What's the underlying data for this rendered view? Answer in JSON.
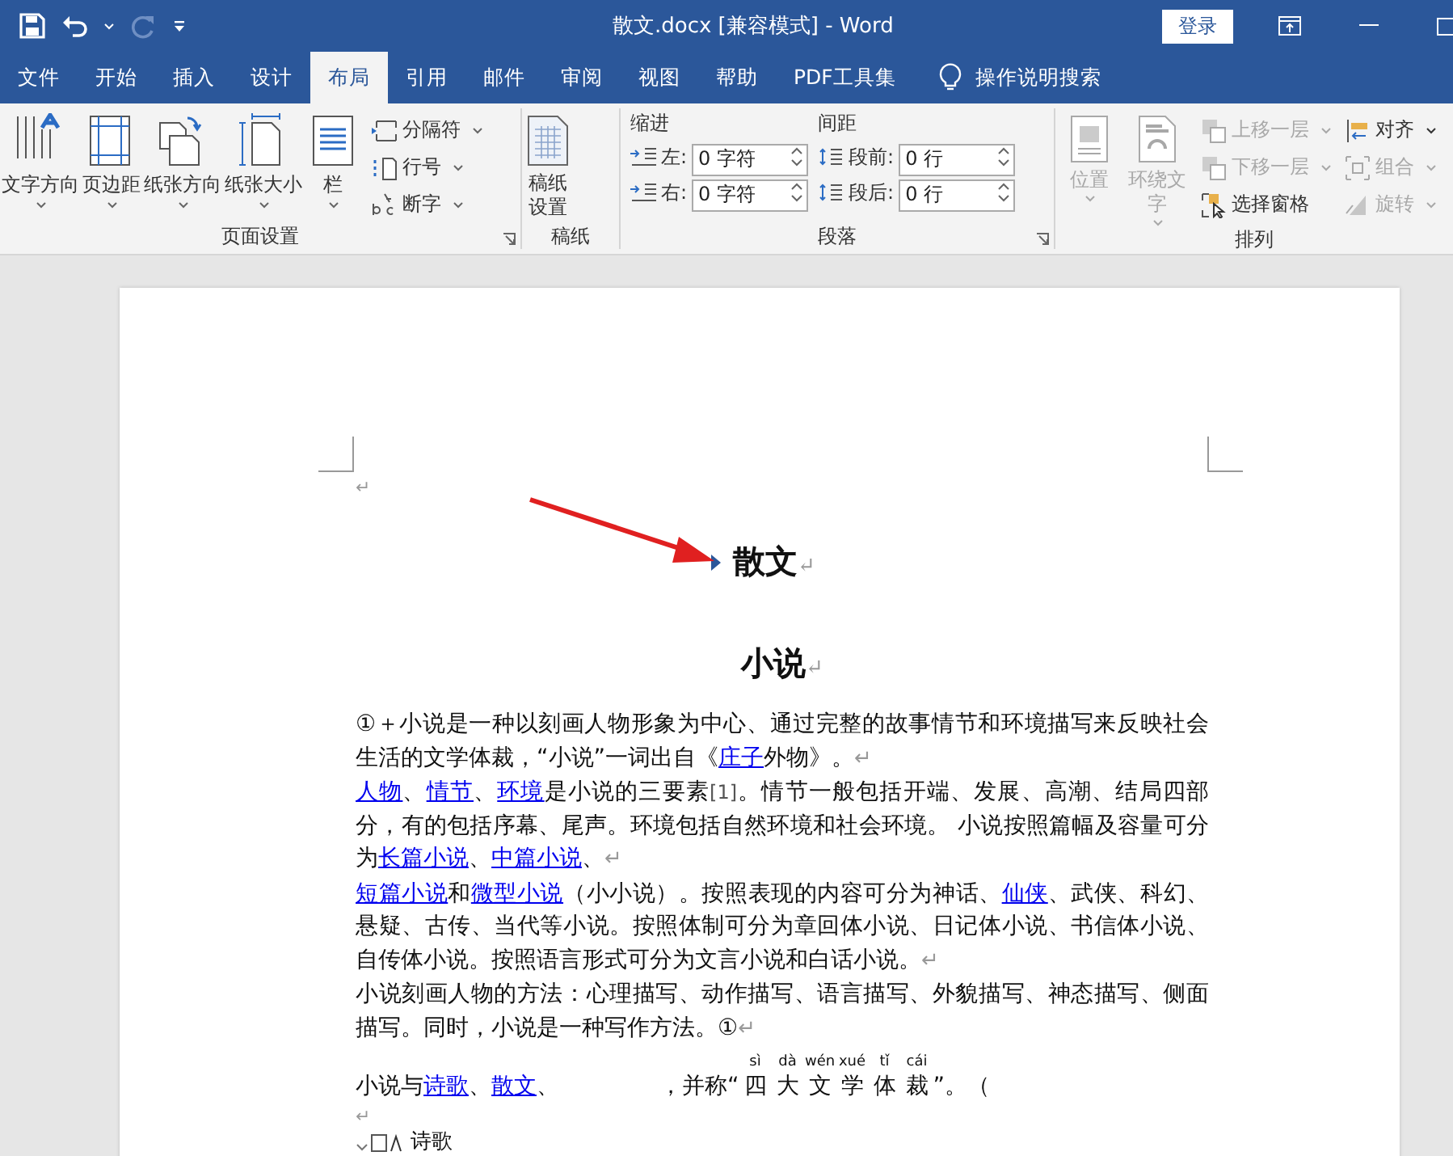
{
  "window": {
    "title": "散文.docx [兼容模式]  -  Word",
    "sign_in": "登录"
  },
  "tabs": [
    {
      "label": "文件",
      "selected": false
    },
    {
      "label": "开始",
      "selected": false
    },
    {
      "label": "插入",
      "selected": false
    },
    {
      "label": "设计",
      "selected": false
    },
    {
      "label": "布局",
      "selected": true
    },
    {
      "label": "引用",
      "selected": false
    },
    {
      "label": "邮件",
      "selected": false
    },
    {
      "label": "审阅",
      "selected": false
    },
    {
      "label": "视图",
      "selected": false
    },
    {
      "label": "帮助",
      "selected": false
    },
    {
      "label": "PDF工具集",
      "selected": false
    }
  ],
  "tell_me": "操作说明搜索",
  "ribbon": {
    "page_setup": {
      "label": "页面设置",
      "big_buttons": [
        "文字方向",
        "页边距",
        "纸张方向",
        "纸张大小",
        "栏"
      ],
      "small_buttons": [
        "分隔符",
        "行号",
        "断字"
      ]
    },
    "manuscript": {
      "label": "稿纸",
      "button": "稿纸设置"
    },
    "paragraph": {
      "label": "段落",
      "indent_label": "缩进",
      "spacing_label": "间距",
      "indent": [
        {
          "label": "左:",
          "value": "0 字符"
        },
        {
          "label": "右:",
          "value": "0 字符"
        }
      ],
      "spacing": [
        {
          "label": "段前:",
          "value": "0 行"
        },
        {
          "label": "段后:",
          "value": "0 行"
        }
      ]
    },
    "arrange": {
      "label": "排列",
      "big_buttons": [
        {
          "label": "位置",
          "disabled": true
        },
        {
          "label": "环绕文字",
          "disabled": true
        }
      ],
      "small_buttons": [
        {
          "label": "上移一层",
          "disabled": true,
          "dropdown": true
        },
        {
          "label": "下移一层",
          "disabled": true,
          "dropdown": true
        },
        {
          "label": "选择窗格",
          "disabled": false,
          "dropdown": false
        }
      ],
      "right_buttons": [
        {
          "label": "对齐",
          "disabled": false
        },
        {
          "label": "组合",
          "disabled": true
        },
        {
          "label": "旋转",
          "disabled": true
        }
      ]
    }
  },
  "document": {
    "paragraphs": [
      {
        "kind": "empty",
        "mark": "↵"
      },
      {
        "kind": "heading",
        "text": "散文",
        "collapsible": true,
        "mark": "↵"
      },
      {
        "kind": "heading",
        "text": "小说",
        "collapsible": false,
        "mark": "↵"
      },
      {
        "kind": "body",
        "segments": [
          {
            "kind": "text",
            "text": "①＋小说是一种以刻画人物形象为中心、通过完整的故事情节和环境描写来反映社会生活的文学体裁，“小说”一词出自《"
          },
          {
            "kind": "link",
            "text": "庄子"
          },
          {
            "kind": "text",
            "text": "外物》。"
          },
          {
            "kind": "mark",
            "text": "↵"
          }
        ]
      },
      {
        "kind": "body",
        "segments": [
          {
            "kind": "link",
            "text": "人物"
          },
          {
            "kind": "text",
            "text": "、"
          },
          {
            "kind": "link",
            "text": "情节"
          },
          {
            "kind": "text",
            "text": "、"
          },
          {
            "kind": "link",
            "text": "环境"
          },
          {
            "kind": "text",
            "text": "是小说的三要素"
          },
          {
            "kind": "note",
            "text": "[1]"
          },
          {
            "kind": "text",
            "text": "。情节一般包括开端、发展、高潮、结局四部分，有的包括序幕、尾声。环境包括自然环境和社会环境。 小说按照篇幅及容量可分为"
          },
          {
            "kind": "link",
            "text": "长篇小说"
          },
          {
            "kind": "text",
            "text": "、"
          },
          {
            "kind": "link",
            "text": "中篇小说"
          },
          {
            "kind": "text",
            "text": "、"
          },
          {
            "kind": "mark",
            "text": "↵"
          }
        ]
      },
      {
        "kind": "body",
        "segments": [
          {
            "kind": "link",
            "text": "短篇小说"
          },
          {
            "kind": "text",
            "text": "和"
          },
          {
            "kind": "link",
            "text": "微型小说"
          },
          {
            "kind": "text",
            "text": "（小小说）。按照表现的内容可分为神话、"
          },
          {
            "kind": "link",
            "text": "仙侠"
          },
          {
            "kind": "text",
            "text": "、武侠、科幻、悬疑、古传、当代等小说。按照体制可分为章回体小说、日记体小说、书信体小说、自传体小说。按照语言形式可分为文言小说和白话小说。"
          },
          {
            "kind": "mark",
            "text": "↵"
          }
        ]
      },
      {
        "kind": "body",
        "segments": [
          {
            "kind": "text",
            "text": "小说刻画人物的方法：心理描写、动作描写、语言描写、外貌描写、神态描写、侧面描写。同时，小说是一种写作方法。①"
          },
          {
            "kind": "mark",
            "text": "↵"
          }
        ]
      },
      {
        "kind": "body",
        "spaced": true,
        "segments": [
          {
            "kind": "text",
            "text": "小说与"
          },
          {
            "kind": "link",
            "text": "诗歌"
          },
          {
            "kind": "text",
            "text": "、"
          },
          {
            "kind": "link",
            "text": "散文"
          },
          {
            "kind": "text",
            "text": "、"
          },
          {
            "kind": "gap"
          },
          {
            "kind": "text",
            "text": "，并称“"
          },
          {
            "kind": "ruby",
            "chars": [
              {
                "base": "四",
                "pinyin": "sì"
              },
              {
                "base": "大",
                "pinyin": "dà"
              },
              {
                "base": "文",
                "pinyin": "wén"
              },
              {
                "base": "学",
                "pinyin": "xué"
              },
              {
                "base": "体",
                "pinyin": "tǐ"
              },
              {
                "base": "裁",
                "pinyin": "cái"
              }
            ]
          },
          {
            "kind": "text",
            "text": "”。（"
          }
        ]
      },
      {
        "kind": "empty",
        "mark": "↵"
      },
      {
        "kind": "list_item",
        "text": "诗歌"
      }
    ]
  }
}
